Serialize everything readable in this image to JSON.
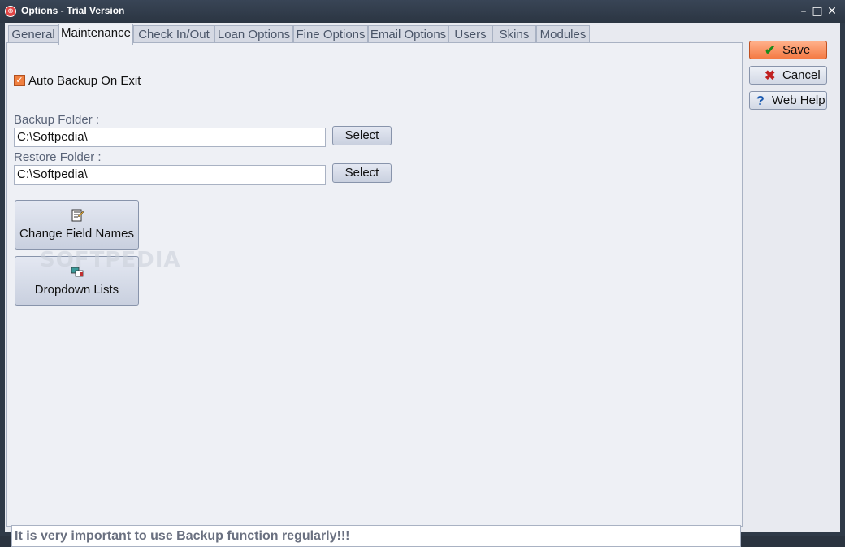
{
  "window": {
    "title": "Options - Trial Version",
    "app_icon": "app-logo-icon",
    "controls": [
      "minimize-icon",
      "maximize-icon",
      "close-icon"
    ]
  },
  "tabs": [
    {
      "label": "General",
      "active": false
    },
    {
      "label": "Maintenance",
      "active": true
    },
    {
      "label": "Check In/Out",
      "active": false
    },
    {
      "label": "Loan Options",
      "active": false
    },
    {
      "label": "Fine Options",
      "active": false
    },
    {
      "label": "Email Options",
      "active": false
    },
    {
      "label": "Users",
      "active": false
    },
    {
      "label": "Skins",
      "active": false
    },
    {
      "label": "Modules",
      "active": false
    }
  ],
  "maintenance": {
    "auto_backup": {
      "label": "Auto Backup On Exit",
      "checked": true
    },
    "backup_folder": {
      "label": "Backup Folder :",
      "value": "C:\\Softpedia\\",
      "select_label": "Select"
    },
    "restore_folder": {
      "label": "Restore Folder :",
      "value": "C:\\Softpedia\\",
      "select_label": "Select"
    },
    "change_field_names": {
      "label": "Change Field Names",
      "icon": "field-names-icon"
    },
    "dropdown_lists": {
      "label": "Dropdown Lists",
      "icon": "dropdown-lists-icon"
    },
    "status_message": "It is very important to use Backup function regularly!!!"
  },
  "side_buttons": {
    "save": {
      "label": "Save",
      "icon": "checkmark-icon"
    },
    "cancel": {
      "label": "Cancel",
      "icon": "x-icon"
    },
    "help": {
      "label": "Web Help",
      "icon": "question-icon"
    }
  },
  "watermark": "SOFTPEDIA",
  "colors": {
    "accent": "#f47a44",
    "titlebar": "#2f3a48",
    "panel": "#eef0f5"
  }
}
